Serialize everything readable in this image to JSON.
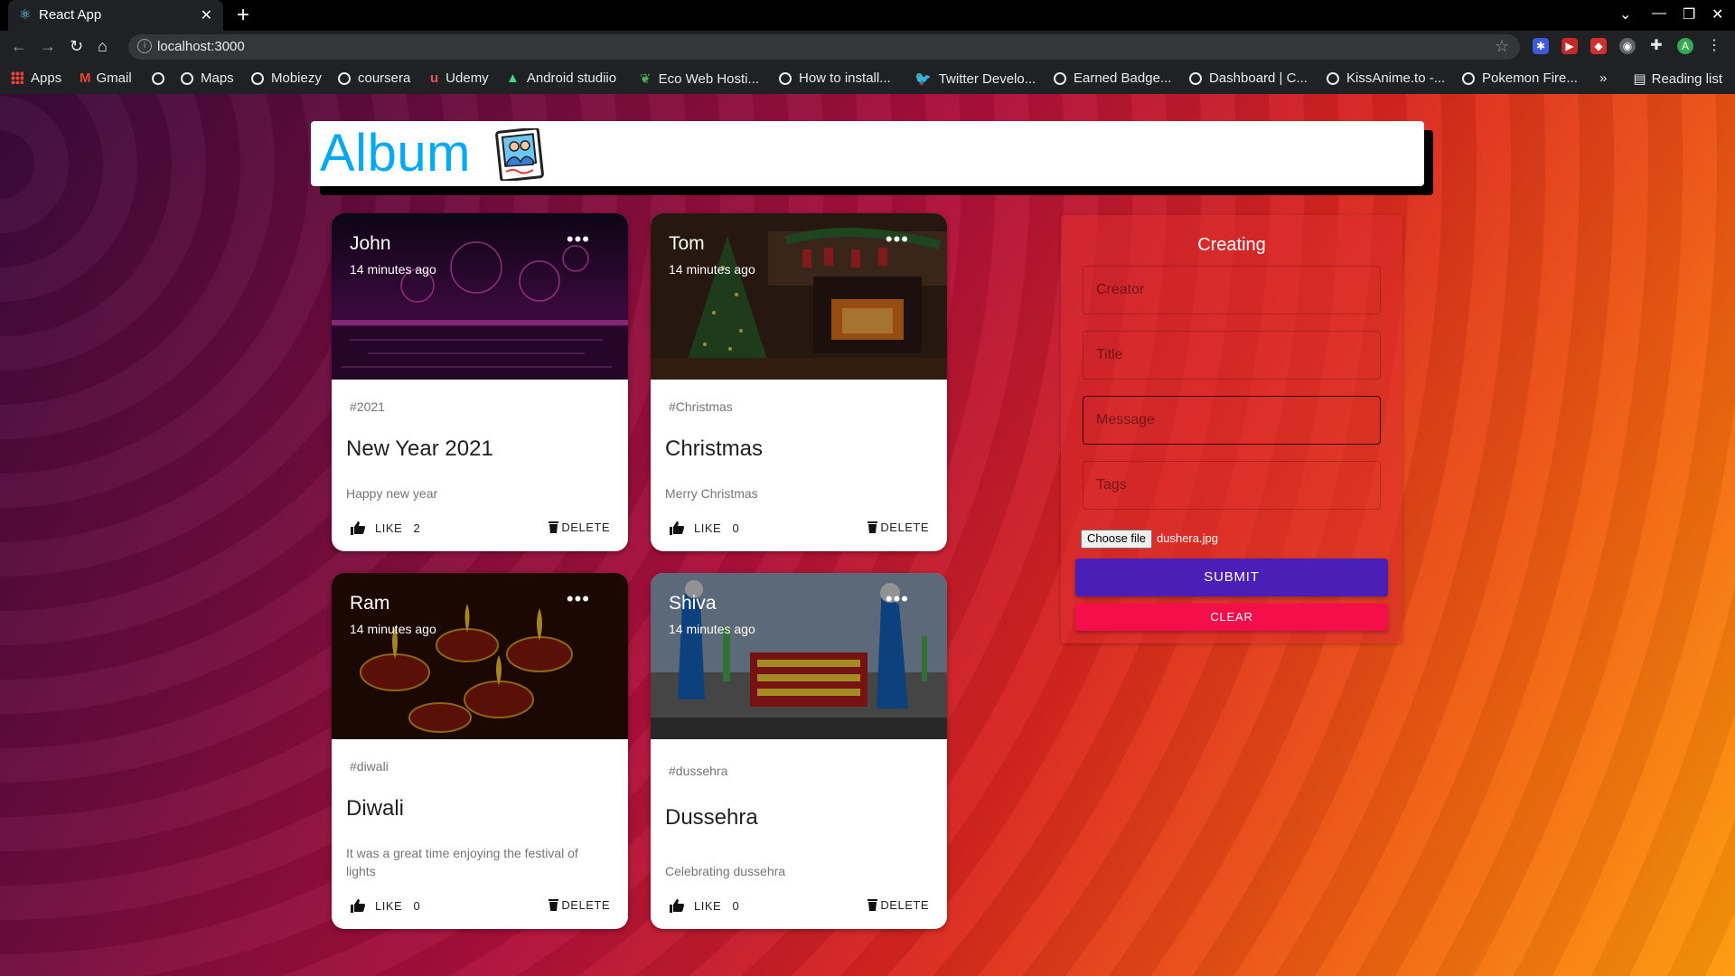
{
  "browser": {
    "tab_title": "React App",
    "url": "localhost:3000",
    "bookmarks": [
      "Apps",
      "Gmail",
      "Maps",
      "Mobiezy",
      "coursera",
      "Udemy",
      "Android studiio",
      "Eco Web Hosti...",
      "How to install...",
      "Twitter Develo...",
      "Earned Badge...",
      "Dashboard | C...",
      "KissAnime.to -...",
      "Pokemon Fire..."
    ],
    "overflow": "»",
    "reading_list": "Reading list",
    "profile_initial": "A"
  },
  "header": {
    "brand": "Album"
  },
  "posts": [
    {
      "creator": "John",
      "time": "14 minutes ago",
      "tags": "#2021",
      "title": "New Year 2021",
      "message": "Happy new year",
      "like_label": "LIKE",
      "likes": "2",
      "delete_label": "DELETE"
    },
    {
      "creator": "Tom",
      "time": "14 minutes ago",
      "tags": "#Christmas",
      "title": "Christmas",
      "message": "Merry Christmas",
      "like_label": "LIKE",
      "likes": "0",
      "delete_label": "DELETE"
    },
    {
      "creator": "Ram",
      "time": "14 minutes ago",
      "tags": "#diwali",
      "title": "Diwali",
      "message": "It was a great time enjoying the festival of lights",
      "like_label": "LIKE",
      "likes": "0",
      "delete_label": "DELETE"
    },
    {
      "creator": "Shiva",
      "time": "14 minutes ago",
      "tags": "#dussehra",
      "title": "Dussehra",
      "message": "Celebrating dussehra",
      "like_label": "LIKE",
      "likes": "0",
      "delete_label": "DELETE"
    }
  ],
  "form": {
    "title": "Creating",
    "creator_placeholder": "Creator",
    "title_placeholder": "Title",
    "message_placeholder": "Message",
    "tags_placeholder": "Tags",
    "choose_file": "Choose file",
    "file_name": "dushera.jpg",
    "submit": "SUBMIT",
    "clear": "CLEAR"
  },
  "colors": {
    "brand": "#03a9f4",
    "submit": "#4a1fb8",
    "clear": "#f50f4a"
  }
}
